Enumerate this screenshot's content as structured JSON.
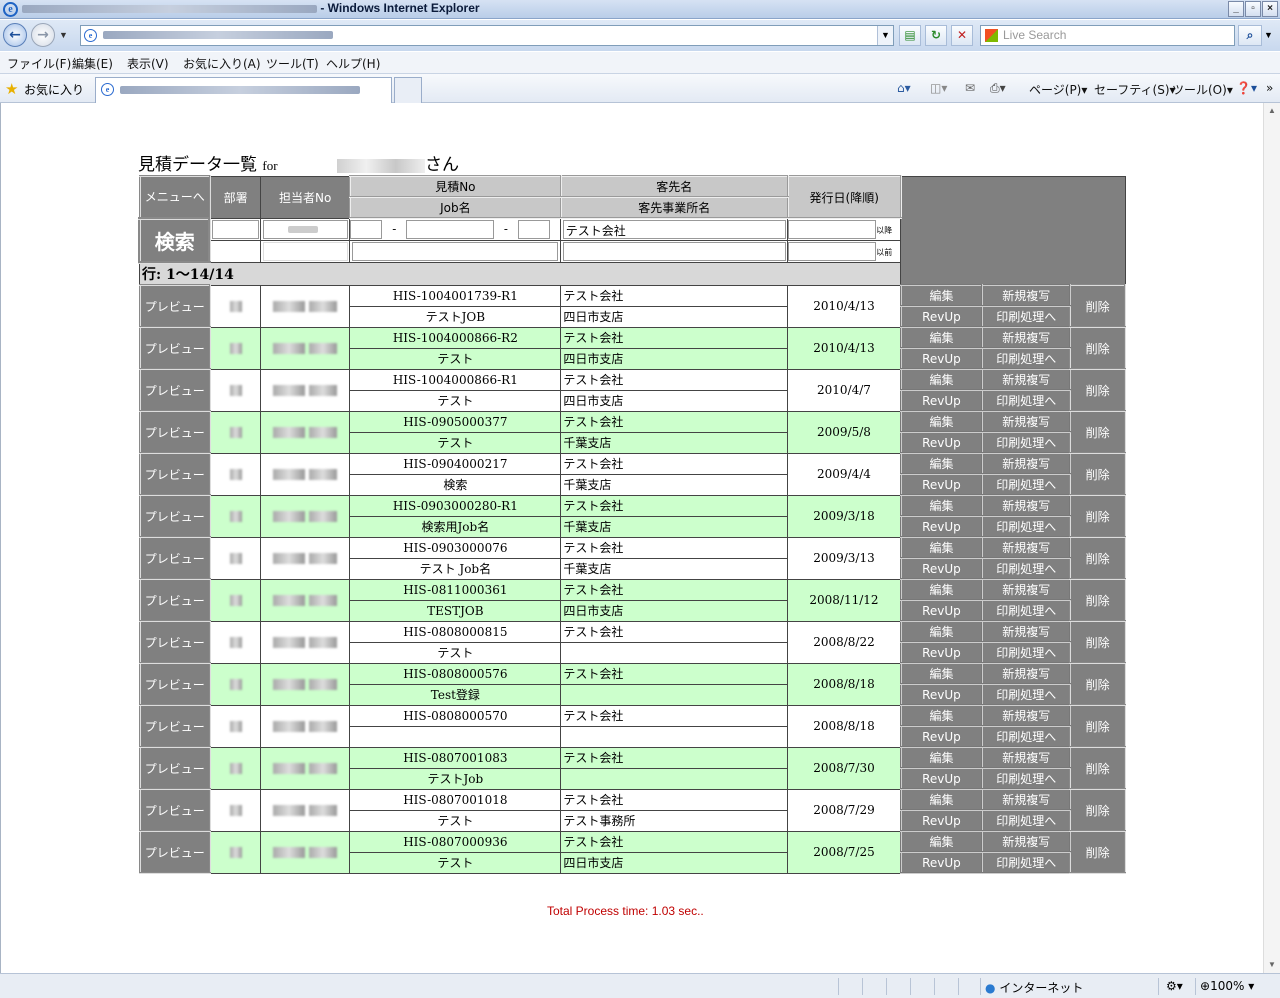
{
  "browser": {
    "title": " - Windows Internet Explorer",
    "search_placeholder": "Live Search",
    "menu": [
      "ファイル(F)",
      "編集(E)",
      "表示(V)",
      "お気に入り(A)",
      "ツール(T)",
      "ヘルプ(H)"
    ],
    "favorites": "お気に入り",
    "commands": [
      "ページ(P)",
      "セーフティ(S)",
      "ツール(O)"
    ],
    "status_zone": "インターネット",
    "zoom": "100%",
    "icons": [
      "ie-logo-icon",
      "back-icon",
      "forward-icon",
      "refresh-icon",
      "stop-icon",
      "search-icon",
      "home-icon",
      "feeds-icon",
      "print-icon",
      "help-icon",
      "star-icon",
      "globe-icon"
    ]
  },
  "page": {
    "heading": "見積データ一覧",
    "heading_for": "for",
    "heading_suffix": "さん",
    "headers": {
      "menu": "メニューへ",
      "dept": "部署",
      "staff": "担当者No",
      "estimate_no": "見積No",
      "job_name": "Job名",
      "client": "客先名",
      "client_office": "客先事業所名",
      "issue_date": "発行日(降順)"
    },
    "search_button": "検索",
    "search": {
      "dash1": "-",
      "dash2": "-",
      "client_value": "テスト会社",
      "after_label": "以降",
      "before_label": "以前"
    },
    "row_count": "行: 1〜14/14",
    "buttons": {
      "preview": "プレビュー",
      "edit": "編集",
      "copy": "新規複写",
      "revup": "RevUp",
      "print": "印刷処理へ",
      "delete": "削除"
    },
    "rows": [
      {
        "no": "HIS-1004001739-R1",
        "job": "テストJOB",
        "client": "テスト会社",
        "office": "四日市支店",
        "date": "2010/4/13"
      },
      {
        "no": "HIS-1004000866-R2",
        "job": "テスト",
        "client": "テスト会社",
        "office": "四日市支店",
        "date": "2010/4/13"
      },
      {
        "no": "HIS-1004000866-R1",
        "job": "テスト",
        "client": "テスト会社",
        "office": " 四日市支店",
        "date": "2010/4/7"
      },
      {
        "no": "HIS-0905000377",
        "job": "テスト",
        "client": "テスト会社",
        "office": "千葉支店",
        "date": "2009/5/8"
      },
      {
        "no": "HIS-0904000217",
        "job": "検索",
        "client": "テスト会社",
        "office": "千葉支店",
        "date": "2009/4/4"
      },
      {
        "no": "HIS-0903000280-R1",
        "job": "検索用Job名",
        "client": "テスト会社",
        "office": "千葉支店",
        "date": "2009/3/18"
      },
      {
        "no": "HIS-0903000076",
        "job": "テスト Job名",
        "client": "テスト会社",
        "office": "千葉支店",
        "date": "2009/3/13"
      },
      {
        "no": "HIS-0811000361",
        "job": "TESTJOB",
        "client": "テスト会社",
        "office": "四日市支店",
        "date": "2008/11/12"
      },
      {
        "no": "HIS-0808000815",
        "job": "テスト",
        "client": "テスト会社",
        "office": "",
        "date": "2008/8/22"
      },
      {
        "no": "HIS-0808000576",
        "job": "Test登録",
        "client": "テスト会社",
        "office": "",
        "date": "2008/8/18"
      },
      {
        "no": "HIS-0808000570",
        "job": "",
        "client": "テスト会社",
        "office": "",
        "date": "2008/8/18"
      },
      {
        "no": "HIS-0807001083",
        "job": "テストJob",
        "client": "テスト会社",
        "office": "",
        "date": "2008/7/30"
      },
      {
        "no": "HIS-0807001018",
        "job": "テスト",
        "client": "テスト会社",
        "office": "テスト事務所",
        "date": "2008/7/29"
      },
      {
        "no": "HIS-0807000936",
        "job": "テスト",
        "client": "テスト会社",
        "office": "四日市支店",
        "date": "2008/7/25"
      }
    ],
    "footer": "Total Process time: 1.03 sec..",
    "colors": {
      "alt_row": "#ccffcc",
      "button_grey": "#808080",
      "footer_red": "#c00000"
    }
  }
}
